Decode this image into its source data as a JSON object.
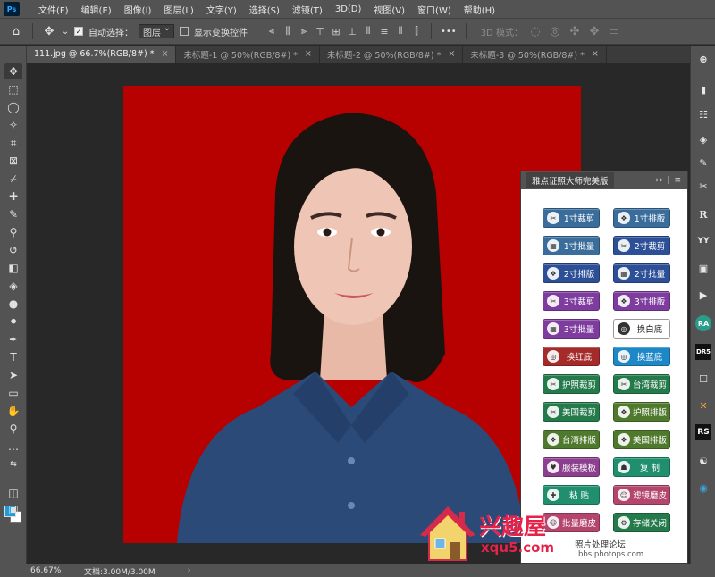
{
  "app": {
    "logo": "Ps"
  },
  "menu": [
    "文件(F)",
    "编辑(E)",
    "图像(I)",
    "图层(L)",
    "文字(Y)",
    "选择(S)",
    "滤镜(T)",
    "3D(D)",
    "视图(V)",
    "窗口(W)",
    "帮助(H)"
  ],
  "options": {
    "auto_select_label": "自动选择：",
    "auto_select_value": "图层",
    "show_transform_label": "显示变换控件",
    "more": "•••",
    "mode_3d_label": "3D 模式："
  },
  "tabs": [
    {
      "label": "111.jpg @ 66.7%(RGB/8#) *",
      "active": true
    },
    {
      "label": "未标题-1 @ 50%(RGB/8#) *",
      "active": false
    },
    {
      "label": "未标题-2 @ 50%(RGB/8#) *",
      "active": false
    },
    {
      "label": "未标题-3 @ 50%(RGB/8#) *",
      "active": false
    }
  ],
  "tab_close": "×",
  "photo": {
    "background": "#b70000"
  },
  "right_column": [
    "⊕",
    "▮",
    "☷",
    "◈",
    "✎",
    "✂",
    "R",
    "YY",
    "▣",
    "▶",
    "RA",
    "DR5",
    "☐",
    "✕",
    "RS",
    "☯",
    "◉"
  ],
  "panel": {
    "title": "雅点证照大师完美版",
    "controls": "›› | ≡",
    "buttons": [
      {
        "label": "1寸裁剪",
        "color": "#3a6d9b",
        "icon": "✂"
      },
      {
        "label": "1寸排版",
        "color": "#3a6d9b",
        "icon": "❖"
      },
      {
        "label": "1寸批量",
        "color": "#3a6d9b",
        "icon": "▦"
      },
      {
        "label": "2寸裁剪",
        "color": "#2c4f97",
        "icon": "✂"
      },
      {
        "label": "2寸排版",
        "color": "#2c4f97",
        "icon": "❖"
      },
      {
        "label": "2寸批量",
        "color": "#2c4f97",
        "icon": "▦"
      },
      {
        "label": "3寸裁剪",
        "color": "#7d3c9e",
        "icon": "✂"
      },
      {
        "label": "3寸排版",
        "color": "#7d3c9e",
        "icon": "❖"
      },
      {
        "label": "3寸批量",
        "color": "#7d3c9e",
        "icon": "▦"
      },
      {
        "label": "换白底",
        "color": "#ffffff",
        "icon": "◎",
        "white": true
      },
      {
        "label": "换红底",
        "color": "#a52a2a",
        "icon": "◎"
      },
      {
        "label": "换蓝底",
        "color": "#1e88c7",
        "icon": "◎"
      },
      {
        "label": "护照裁剪",
        "color": "#247a4a",
        "icon": "✂"
      },
      {
        "label": "台湾裁剪",
        "color": "#247a4a",
        "icon": "✂"
      },
      {
        "label": "美国裁剪",
        "color": "#247a4a",
        "icon": "✂"
      },
      {
        "label": "护照排版",
        "color": "#4f7a2e",
        "icon": "❖"
      },
      {
        "label": "台湾排版",
        "color": "#4f7a2e",
        "icon": "❖"
      },
      {
        "label": "美国排版",
        "color": "#4f7a2e",
        "icon": "❖"
      },
      {
        "label": "服装模板",
        "color": "#8b3f8e",
        "icon": "♥"
      },
      {
        "label": "复  制",
        "color": "#1f8f6e",
        "icon": "☗"
      },
      {
        "label": "粘  贴",
        "color": "#1f8f6e",
        "icon": "✚"
      },
      {
        "label": "滤镜磨皮",
        "color": "#b4466d",
        "icon": "☺"
      },
      {
        "label": "批量磨皮",
        "color": "#b4466d",
        "icon": "☺"
      },
      {
        "label": "存储关闭",
        "color": "#247a4a",
        "icon": "⚙"
      }
    ],
    "footer_title": "照片处理论坛",
    "footer_url": "bbs.photops.com"
  },
  "watermark": {
    "title": "兴趣屋",
    "url": "xqu5.com"
  },
  "status": {
    "zoom": "66.67%",
    "doc": "文档:3.00M/3.00M",
    "arrow": "›"
  }
}
